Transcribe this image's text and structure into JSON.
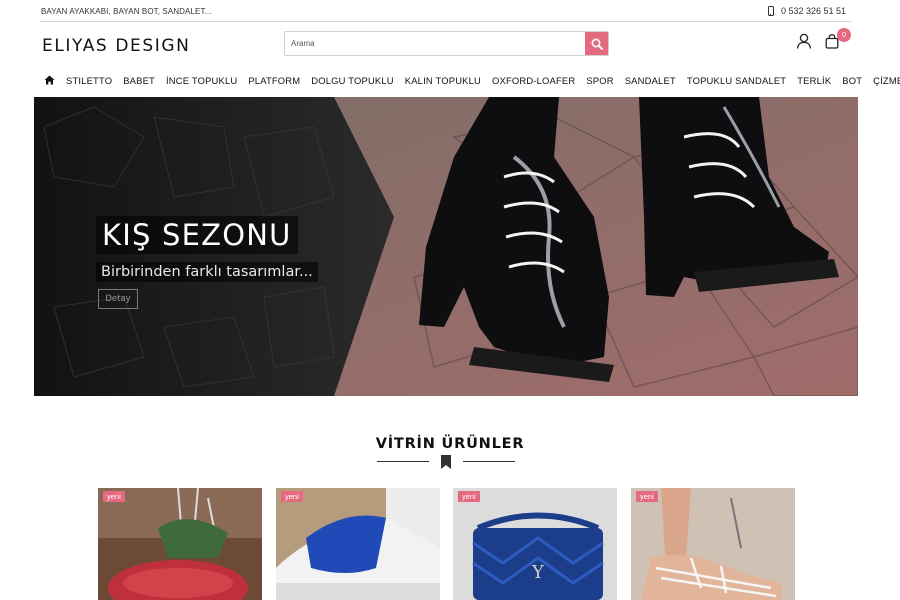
{
  "topbar": {
    "slogan": "BAYAN AYAKKABI, BAYAN BOT, SANDALET...",
    "phone": "0 532 326 51 51"
  },
  "header": {
    "logo": "ELIYAS DESIGN",
    "search_placeholder": "Arama",
    "cart_count": "0"
  },
  "nav": {
    "items": [
      "STILETTO",
      "BABET",
      "İNCE TOPUKLU",
      "PLATFORM",
      "DOLGU TOPUKLU",
      "KALIN TOPUKLU",
      "OXFORD-LOAFER",
      "SPOR",
      "SANDALET",
      "TOPUKLU SANDALET",
      "TERLİK",
      "BOT",
      "ÇİZME"
    ]
  },
  "hero": {
    "title": "KIŞ SEZONU",
    "subtitle": "Birbirinden farklı tasarımlar...",
    "button": "Detay"
  },
  "showcase": {
    "title": "VİTRİN ÜRÜNLER",
    "products": [
      {
        "tag": "yeni"
      },
      {
        "tag": "yeni"
      },
      {
        "tag": "yeni"
      },
      {
        "tag": "yeni"
      }
    ]
  },
  "colors": {
    "accent": "#e46a7f",
    "text": "#111111"
  }
}
